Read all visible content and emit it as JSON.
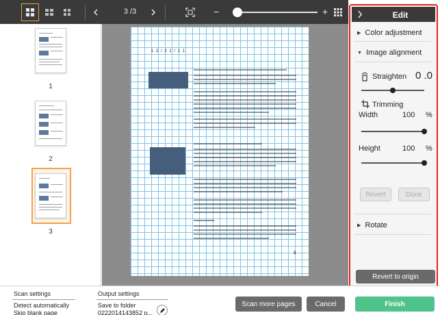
{
  "toolbar": {
    "page_counter": "3 /3",
    "zoom_minus": "−",
    "zoom_plus": "+",
    "zoom_level": 0.06
  },
  "thumbnails": [
    {
      "number": "1",
      "selected": false
    },
    {
      "number": "2",
      "selected": false
    },
    {
      "number": "3",
      "selected": true
    }
  ],
  "preview": {
    "date_text": "1 2 / 2 1 / 1 1",
    "page_number": "3"
  },
  "edit_panel": {
    "title": "Edit",
    "color_adjustment": "Color adjustment",
    "image_alignment": "Image alignment",
    "straighten_label": "Straighten",
    "straighten_value": "0 .0",
    "straighten_level": 0.5,
    "trimming_label": "Trimming",
    "width_label": "Width",
    "width_value": "100",
    "width_unit": "%",
    "width_level": 1.0,
    "height_label": "Height",
    "height_value": "100",
    "height_unit": "%",
    "height_level": 1.0,
    "revert_label": "Revert",
    "done_label": "Done",
    "rotate_label": "Rotate",
    "revert_origin_label": "Revert to origin"
  },
  "bottom": {
    "scan_settings_heading": "Scan settings",
    "scan_detect": "Detect automatically",
    "scan_skip": "Skip blank page",
    "output_settings_heading": "Output settings",
    "save_to_folder": "Save to folder",
    "folder_name": "0222014143852 p...",
    "scan_more_label": "Scan more pages",
    "cancel_label": "Cancel",
    "finish_label": "Finish"
  },
  "colors": {
    "toolbar_bg": "#3a3a3a",
    "highlight_border": "#e02020",
    "selected_thumb": "#f0a24a",
    "finish_bg": "#4fc38a",
    "grid_line": "#7cc4e6"
  }
}
